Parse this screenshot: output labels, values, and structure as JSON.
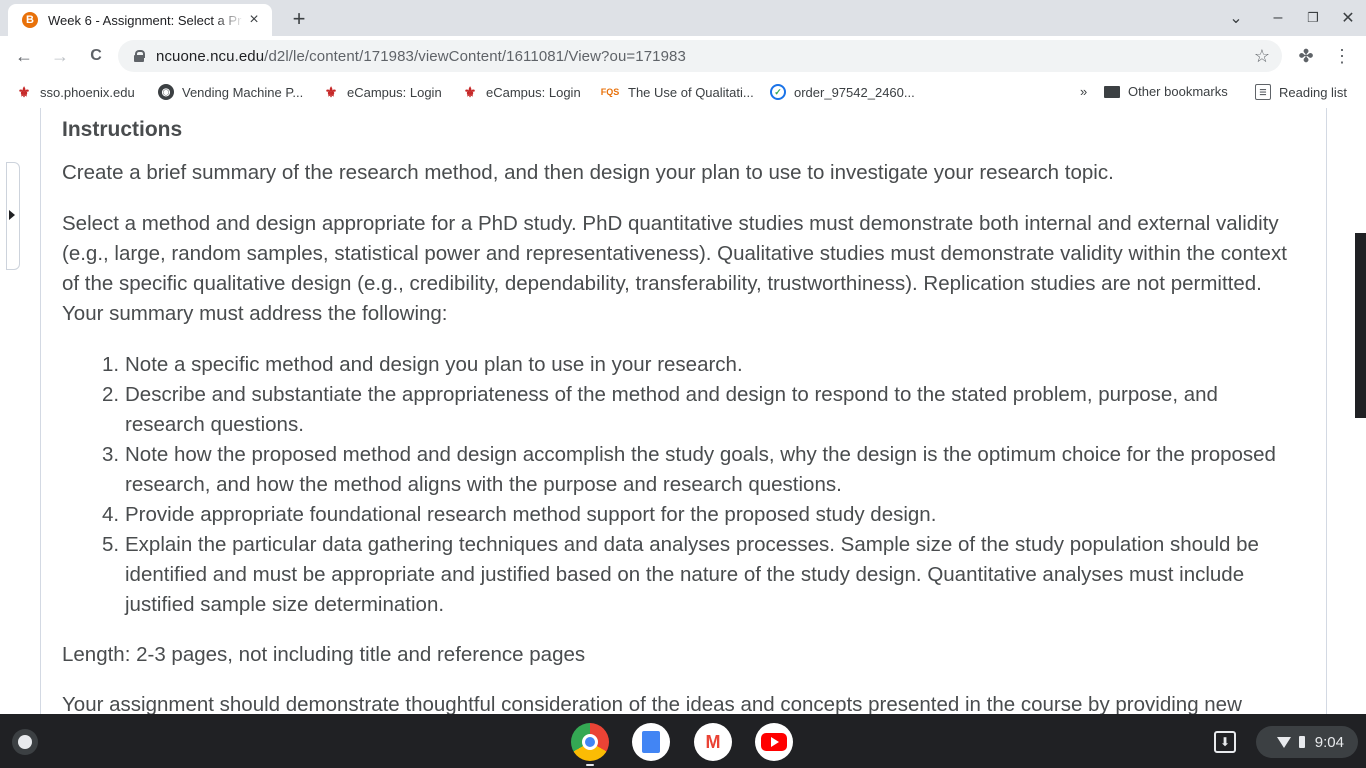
{
  "tab": {
    "favicon": "B",
    "title": "Week 6 - Assignment: Select a Pr",
    "close_icon": "×"
  },
  "toolbar": {
    "url_host": "ncuone.ncu.edu",
    "url_path": "/d2l/le/content/171983/viewContent/1611081/View?ou=171983",
    "back_icon": "←",
    "forward_icon": "→",
    "reload_icon": "C",
    "star_icon": "☆",
    "ext_icon": "✤",
    "menu_icon": "⋮"
  },
  "window": {
    "dropdown": "⌄",
    "minimize": "–",
    "restore": "❐",
    "close": "✕",
    "newtab": "+"
  },
  "bookmarks": [
    {
      "label": "sso.phoenix.edu",
      "icon": "phoenix-icon"
    },
    {
      "label": "Vending Machine P...",
      "icon": "globe-icon"
    },
    {
      "label": "eCampus: Login",
      "icon": "phoenix-icon"
    },
    {
      "label": "eCampus: Login",
      "icon": "phoenix-icon"
    },
    {
      "label": "The Use of Qualitati...",
      "icon": "fqs-icon",
      "icon_text": "FQS"
    },
    {
      "label": "order_97542_2460...",
      "icon": "check-icon"
    }
  ],
  "bookmarks_more": "»",
  "other_bookmarks": "Other bookmarks",
  "reading_list": "Reading list",
  "content": {
    "heading": "Instructions",
    "intro": "Create a brief summary of the research method, and then design your plan to use to investigate your research topic.",
    "para2": "Select a method and design appropriate for a PhD study.  PhD quantitative studies must demonstrate both internal and external validity (e.g., large, random samples, statistical power and representativeness). Qualitative studies must demonstrate validity within the context of the specific qualitative design (e.g., credibility, dependability, transferability, trustworthiness). Replication studies are not permitted. Your summary must address the following:",
    "list": [
      "Note a specific method and design you plan to use in your research.",
      "Describe and substantiate the appropriateness of the method and design to respond to the stated problem, purpose, and research questions.",
      "Note how the proposed method and design accomplish the study goals, why the design is the optimum choice for the proposed research, and how the method aligns with the purpose and research questions.",
      "Provide appropriate foundational research method support for the proposed study design.",
      "Explain the particular data gathering techniques and data analyses processes.  Sample size of the study population should be identified and must be appropriate and justified based on the nature of the study design. Quantitative analyses must include justified sample size determination."
    ],
    "length": "Length: 2-3 pages, not including title and reference pages",
    "closing": "Your assignment should demonstrate thoughtful consideration of the ideas and concepts presented in the course by providing new"
  },
  "shelf": {
    "time": "9:04",
    "gmail": "M"
  }
}
